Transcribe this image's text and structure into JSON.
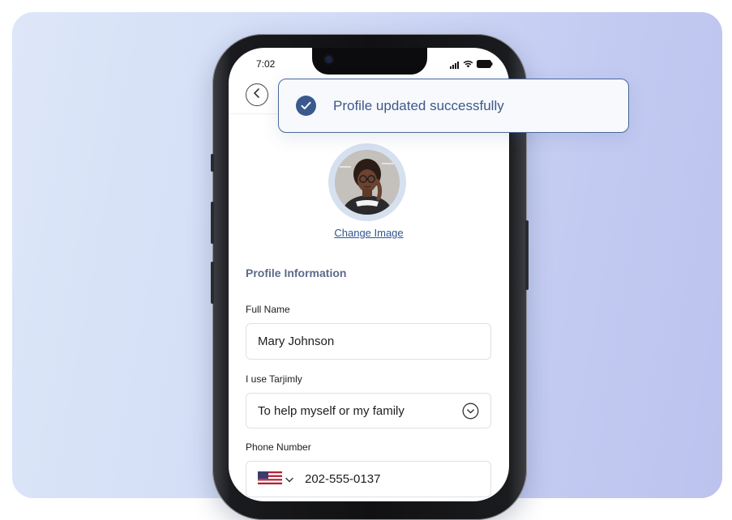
{
  "status_bar": {
    "time": "7:02"
  },
  "profile": {
    "change_image_label": "Change Image",
    "section_title": "Profile Information"
  },
  "form": {
    "full_name": {
      "label": "Full Name",
      "value": "Mary Johnson"
    },
    "usage": {
      "label": "I use Tarjimly",
      "value": "To help myself or my family"
    },
    "phone": {
      "label": "Phone Number",
      "value": "202-555-0137",
      "country_flag": "us-flag-icon"
    }
  },
  "toast": {
    "message": "Profile updated successfully",
    "icon": "check-circle-icon"
  },
  "colors": {
    "accent": "#3a5a8d",
    "link": "#2f558f",
    "section_title": "#5b6b8b",
    "toast_border": "#4a6898"
  }
}
